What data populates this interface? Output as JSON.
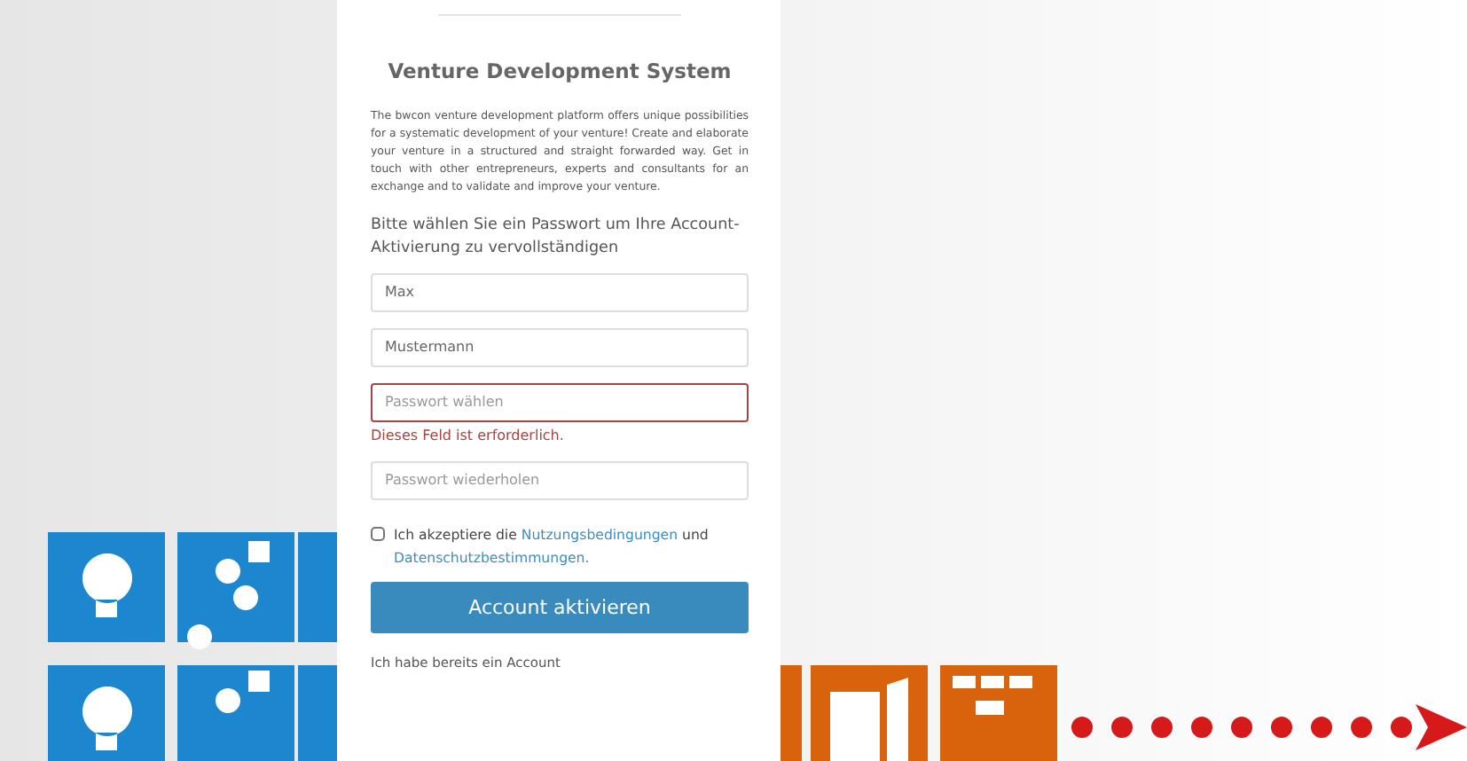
{
  "card": {
    "title": "Venture Development System",
    "intro": "The bwcon venture development platform offers unique possibilities for a systematic development of your venture! Create and elaborate your venture in a structured and straight forwarded way. Get in touch with other entrepreneurs, experts and consultants for an exchange and to validate and improve your venture.",
    "prompt": "Bitte wählen Sie ein Passwort um Ihre Account-Aktivierung zu vervollständigen",
    "fields": [
      {
        "value": "Max",
        "invalid": false
      },
      {
        "value": "Mustermann",
        "invalid": false
      },
      {
        "placeholder": "Passwort wählen",
        "invalid": true,
        "error": "Dieses Feld ist erforderlich."
      },
      {
        "placeholder": "Passwort wiederholen",
        "invalid": false
      }
    ],
    "terms": {
      "checked": false,
      "parts": [
        {
          "kind": "text",
          "text": "Ich akzeptiere die"
        },
        {
          "kind": "link",
          "text": "Nutzungsbedingungen"
        },
        {
          "kind": "text",
          "text": "und"
        },
        {
          "kind": "link",
          "text": "Datenschutzbestimmungen."
        }
      ]
    },
    "submit": "Account aktivieren",
    "login_link": "Ich habe bereits ein Account"
  }
}
